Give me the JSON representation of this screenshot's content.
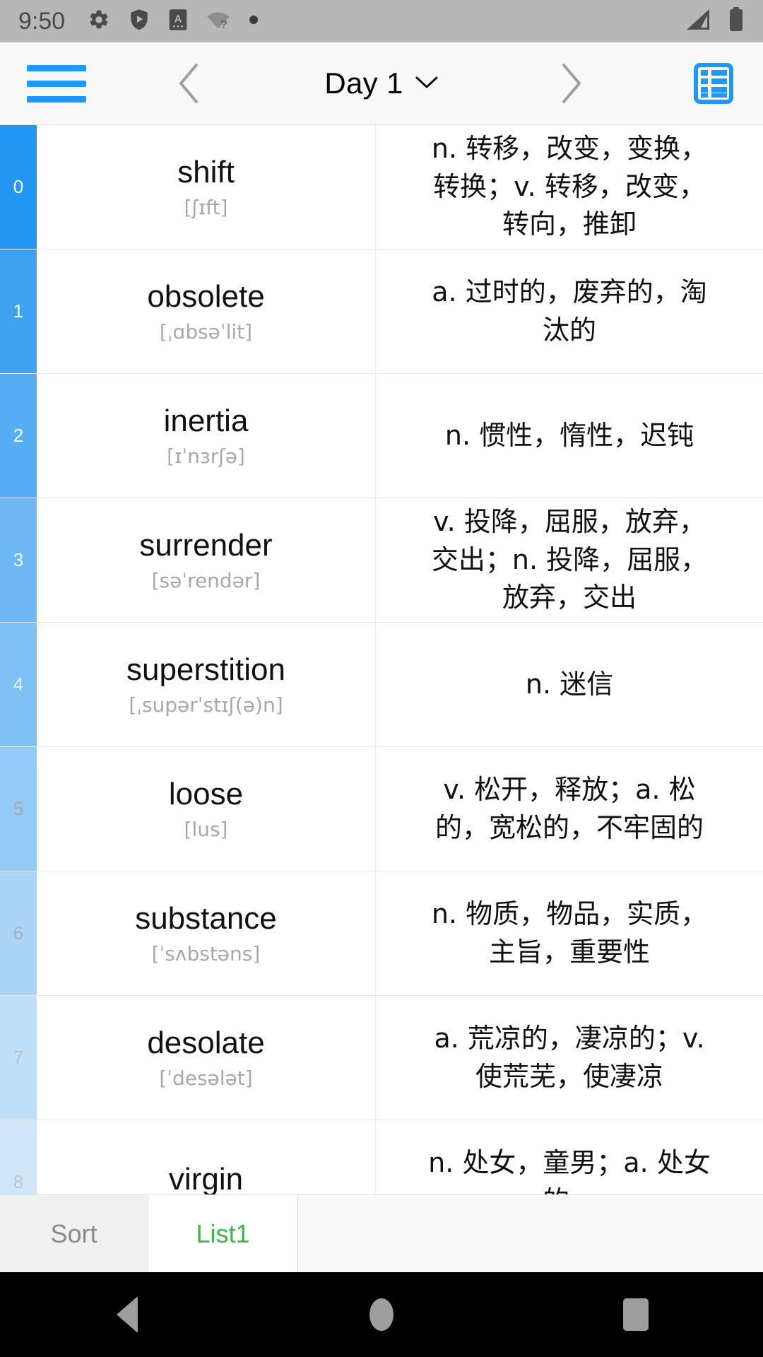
{
  "status_bar": {
    "time": "9:50",
    "icons_left": [
      "gear-icon",
      "shield-play-icon",
      "a-box-icon",
      "wifi-question-icon",
      "dot-icon"
    ],
    "icons_right": [
      "cellular-signal-icon",
      "battery-icon"
    ],
    "background_color": "#b7b7b7"
  },
  "toolbar": {
    "menu_icon": "hamburger-icon",
    "prev_label": "chevron-left-icon",
    "next_label": "chevron-right-icon",
    "title": "Day 1",
    "title_dropdown_icon": "chevron-down-icon",
    "view_icon": "table-view-icon",
    "accent_color": "#2196f3",
    "background_color": "#f8f8f8"
  },
  "list": {
    "rows": [
      {
        "index": "0",
        "word": "shift",
        "phonetic": "[ʃɪft]",
        "definition": "n. 转移，改变，变换，转换；v. 转移，改变，转向，推卸",
        "index_bg": "#2196f3",
        "index_color": "#ffffff"
      },
      {
        "index": "1",
        "word": "obsolete",
        "phonetic": "[ˌɑbsəˈlit]",
        "definition": "a. 过时的，废弃的，淘汰的",
        "index_bg": "#3fa2f0",
        "index_color": "#ffffff"
      },
      {
        "index": "2",
        "word": "inertia",
        "phonetic": "[ɪˈnɜrʃə]",
        "definition": "n. 惯性，惰性，迟钝",
        "index_bg": "#56adf2",
        "index_color": "#ffffff"
      },
      {
        "index": "3",
        "word": "surrender",
        "phonetic": "[səˈrendər]",
        "definition": "v. 投降，屈服，放弃，交出；n. 投降，屈服，放弃，交出",
        "index_bg": "#6db8f4",
        "index_color": "#f0f6fb"
      },
      {
        "index": "4",
        "word": "superstition",
        "phonetic": "[ˌsupərˈstɪʃ(ə)n]",
        "definition": "n. 迷信",
        "index_bg": "#7fc0f5",
        "index_color": "#e6f1fa"
      },
      {
        "index": "5",
        "word": "loose",
        "phonetic": "[lus]",
        "definition": "v. 松开，释放；a. 松的，宽松的，不牢固的",
        "index_bg": "#94caf7",
        "index_color": "#a9a9a9"
      },
      {
        "index": "6",
        "word": "substance",
        "phonetic": "[ˈsʌbstəns]",
        "definition": "n. 物质，物品，实质，主旨，重要性",
        "index_bg": "#aad5f8",
        "index_color": "#b0b0b0"
      },
      {
        "index": "7",
        "word": "desolate",
        "phonetic": "[ˈdesələt]",
        "definition": "a. 荒凉的，凄凉的；v. 使荒芜，使凄凉",
        "index_bg": "#bfdff9",
        "index_color": "#bdbdbd"
      },
      {
        "index": "8",
        "word": "virgin",
        "phonetic": "",
        "definition": "n. 处女，童男；a. 处女的，",
        "index_bg": "#cfe7fb",
        "index_color": "#c5c5c5"
      }
    ]
  },
  "tabbar": {
    "sort_label": "Sort",
    "list_label": "List1",
    "list_color": "#3cb54a",
    "sort_color": "#8a8a8a"
  },
  "navbar": {
    "back": "back-triangle-icon",
    "home": "home-circle-icon",
    "recents": "recents-square-icon"
  }
}
